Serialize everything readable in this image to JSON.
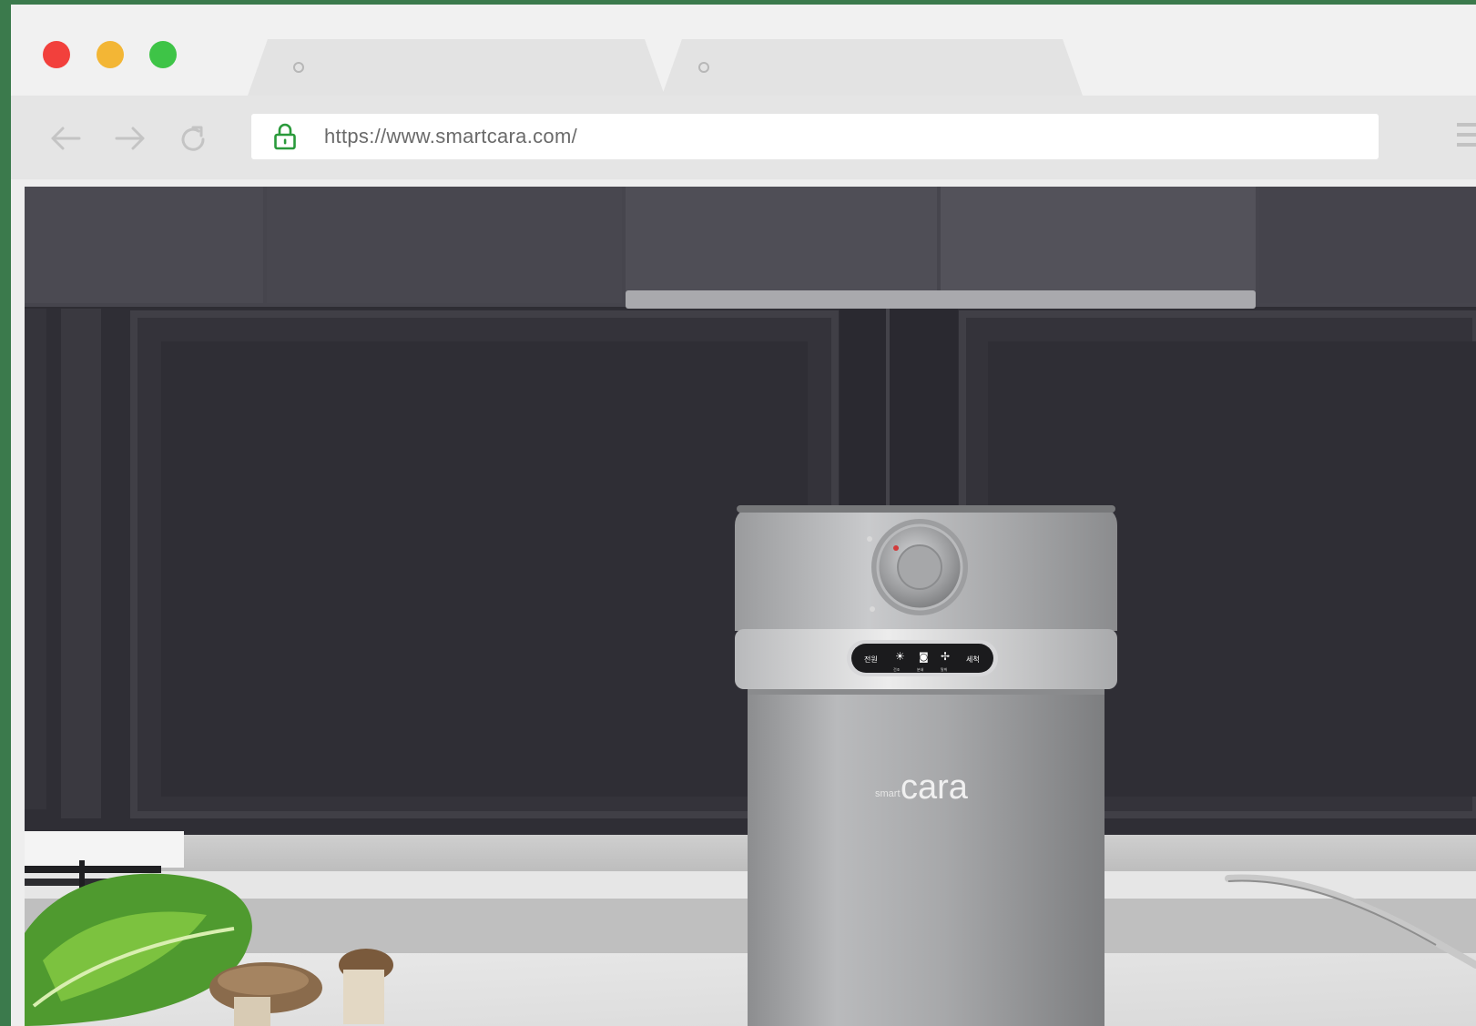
{
  "browser": {
    "window_controls": [
      "close",
      "minimize",
      "maximize"
    ],
    "tabs": [
      {
        "label": ""
      },
      {
        "label": ""
      }
    ],
    "nav": {
      "back_icon": "arrow-left-icon",
      "forward_icon": "arrow-right-icon",
      "reload_icon": "reload-icon"
    },
    "address_bar": {
      "url": "https://www.smartcara.com/",
      "secure_icon": "lock-icon",
      "accent": "#2a9a3b"
    },
    "menu_icon": "hamburger-icon"
  },
  "page": {
    "product_brand_small": "smart",
    "product_brand": "cara",
    "panel_buttons": [
      "전원",
      "건조",
      "분쇄",
      "탈취",
      "세척"
    ]
  },
  "colors": {
    "frame_background": "#3b7a4c",
    "dot_red": "#f2403c",
    "dot_yellow": "#f3b635",
    "dot_green": "#3ec447"
  }
}
